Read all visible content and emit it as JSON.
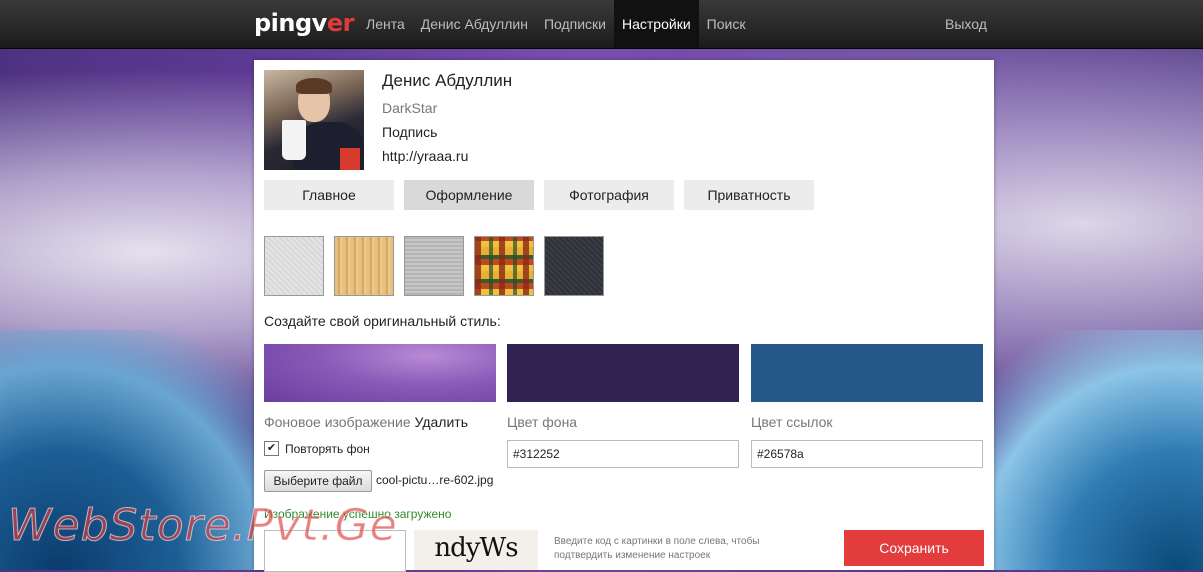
{
  "brand": {
    "logo_main": "pingv",
    "logo_accent": "er"
  },
  "nav": {
    "items": [
      "Лента",
      "Денис Абдуллин",
      "Подписки",
      "Настройки",
      "Поиск"
    ],
    "logout": "Выход"
  },
  "profile": {
    "name": "Денис Абдуллин",
    "login": "DarkStar",
    "signature": "Подпись",
    "url": "http://yraaa.ru"
  },
  "tabs": [
    "Главное",
    "Оформление",
    "Фотография",
    "Приватность"
  ],
  "design": {
    "style_title": "Создайте свой оригинальный стиль:",
    "bg_image_label": "Фоновое изображение",
    "delete_label": "Удалить",
    "bg_color_label": "Цвет фона",
    "link_color_label": "Цвет ссылок",
    "repeat_label": "Повторять фон",
    "repeat_check": "✔",
    "bg_color_value": "#312252",
    "link_color_value": "#26578a",
    "file_button": "Выберите файл",
    "file_name": "cool-pictu…re-602.jpg",
    "success_msg": "Изображение успешно загружено"
  },
  "captcha": {
    "image_text": "ndyWs",
    "hint": "Введите код с картинки в поле слева, чтобы подтвердить изменение настроек"
  },
  "save_button": "Сохранить",
  "watermark": "WebStore.Pvt.Ge",
  "colors": {
    "bg": "#312252",
    "links": "#26578a",
    "save": "#e23c3c"
  }
}
